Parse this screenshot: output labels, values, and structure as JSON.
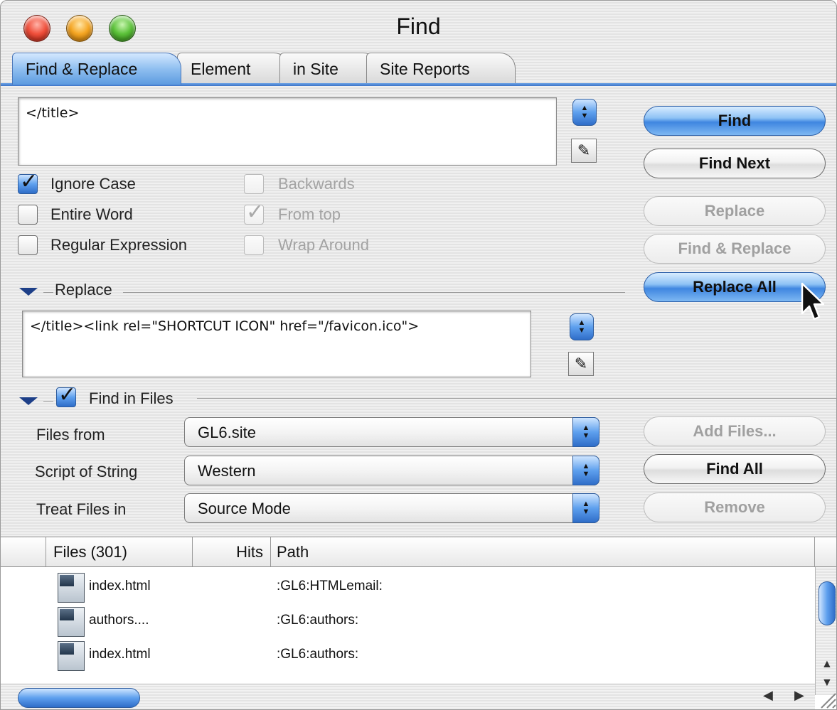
{
  "window": {
    "title": "Find"
  },
  "tabs": [
    {
      "label": "Find & Replace",
      "active": true
    },
    {
      "label": "Element",
      "active": false
    },
    {
      "label": "in Site",
      "active": false
    },
    {
      "label": "Site Reports",
      "active": false
    }
  ],
  "find": {
    "value": "</title>"
  },
  "options": {
    "ignore_case": {
      "label": "Ignore Case",
      "checked": true
    },
    "entire_word": {
      "label": "Entire Word",
      "checked": false
    },
    "regular_expression": {
      "label": "Regular Expression",
      "checked": false
    },
    "backwards": {
      "label": "Backwards",
      "checked": false,
      "enabled": false
    },
    "from_top": {
      "label": "From top",
      "checked": true,
      "enabled": false
    },
    "wrap_around": {
      "label": "Wrap Around",
      "checked": false,
      "enabled": false
    }
  },
  "buttons": {
    "find": "Find",
    "find_next": "Find Next",
    "replace": "Replace",
    "find_and_replace": "Find & Replace",
    "replace_all": "Replace All",
    "add_files": "Add Files...",
    "find_all": "Find All",
    "remove": "Remove"
  },
  "replace_section": {
    "label": "Replace",
    "value": "</title><link rel=\"SHORTCUT ICON\" href=\"/favicon.ico\">"
  },
  "find_in_files": {
    "label": "Find in Files",
    "checked": true,
    "files_from": {
      "label": "Files from",
      "value": "GL6.site"
    },
    "script_of_string": {
      "label": "Script of String",
      "value": "Western"
    },
    "treat_files_in": {
      "label": "Treat Files in",
      "value": "Source Mode"
    }
  },
  "results": {
    "columns": {
      "files": "Files (301)",
      "hits": "Hits",
      "path": "Path"
    },
    "rows": [
      {
        "file": "index.html",
        "hits": "",
        "path": ":GL6:HTMLemail:"
      },
      {
        "file": "authors....",
        "hits": "",
        "path": ":GL6:authors:"
      },
      {
        "file": "index.html",
        "hits": "",
        "path": ":GL6:authors:"
      }
    ]
  },
  "icons": {
    "close": "close-light-icon",
    "minimize": "minimize-light-icon",
    "zoom": "zoom-light-icon",
    "pencil": "pencil-icon",
    "stepper": "popup-stepper-icon",
    "file": "html-file-icon",
    "cursor": "mouse-pointer-icon"
  },
  "colors": {
    "accent_blue": "#3f86e0",
    "tab_line": "#3d74c7",
    "disclosure": "#1d3f88",
    "disabled_text": "#a3a3a3"
  }
}
